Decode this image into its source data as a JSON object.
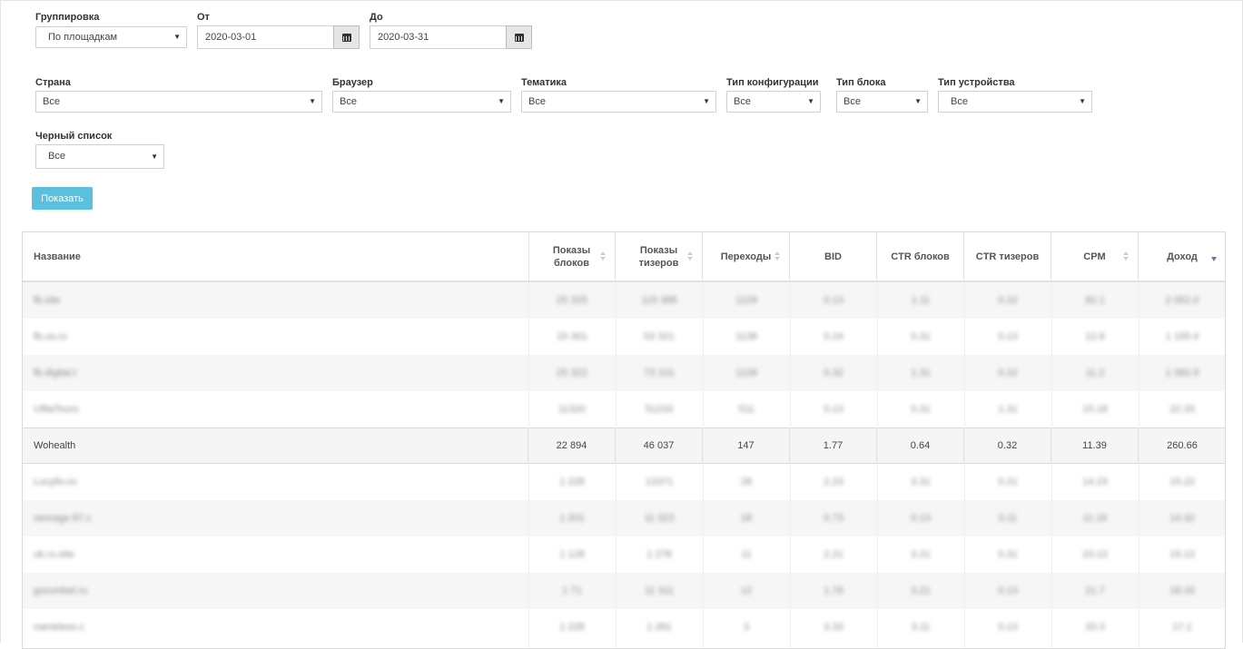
{
  "filters": {
    "grouping": {
      "label": "Группировка",
      "value": "По площадкам"
    },
    "from": {
      "label": "От",
      "value": "2020-03-01"
    },
    "to": {
      "label": "До",
      "value": "2020-03-31"
    },
    "country": {
      "label": "Страна",
      "value": "Все"
    },
    "browser": {
      "label": "Браузер",
      "value": "Все"
    },
    "theme": {
      "label": "Тематика",
      "value": "Все"
    },
    "config_type": {
      "label": "Тип конфигурации",
      "value": "Все"
    },
    "block_type": {
      "label": "Тип блока",
      "value": "Все"
    },
    "device_type": {
      "label": "Тип устройства",
      "value": "Все"
    },
    "blacklist": {
      "label": "Черный список",
      "value": "Все"
    }
  },
  "show_button": "Показать",
  "table": {
    "columns": [
      "Название",
      "Показы блоков",
      "Показы тизеров",
      "Переходы",
      "BID",
      "CTR блоков",
      "CTR тизеров",
      "CPM",
      "Доход"
    ],
    "sorted_column": "Доход",
    "rows": [
      {
        "blurred": true,
        "cells": [
          "fb.site",
          "25 325",
          "115 388",
          "1129",
          "0.13",
          "1.11",
          "0.22",
          "82.1",
          "2 052.0"
        ]
      },
      {
        "blurred": true,
        "cells": [
          "fb.us.ru",
          "15 301",
          "53 321",
          "1138",
          "0.24",
          "0.31",
          "0.13",
          "12.8",
          "1 155.4"
        ]
      },
      {
        "blurred": true,
        "cells": [
          "fb.digital.t",
          "25 322",
          "73 101",
          "1128",
          "0.32",
          "1.31",
          "0.22",
          "11.2",
          "1 082.9"
        ]
      },
      {
        "blurred": true,
        "cells": [
          "UfitaTours",
          "11320",
          "51233",
          "511",
          "0.13",
          "0.31",
          "1.31",
          "15.18",
          "22.33"
        ]
      },
      {
        "blurred": false,
        "highlight": true,
        "cells": [
          "Wohealth",
          "22 894",
          "46 037",
          "147",
          "1.77",
          "0.64",
          "0.32",
          "11.39",
          "260.66"
        ]
      },
      {
        "blurred": true,
        "cells": [
          "Lucyliv.co",
          "1 228",
          "13371",
          "28",
          "2.23",
          "3.31",
          "0.21",
          "14.23",
          "15.22"
        ]
      },
      {
        "blurred": true,
        "cells": [
          "zenrage.87.c",
          "1 201",
          "11 323",
          "18",
          "0.73",
          "0.13",
          "0.11",
          "11.16",
          "14.32"
        ]
      },
      {
        "blurred": true,
        "cells": [
          "uk.ru.site",
          "1 128",
          "1 278",
          "11",
          "2.21",
          "3.21",
          "0.31",
          "23.13",
          "19.13"
        ]
      },
      {
        "blurred": true,
        "cells": [
          "gurumbet.ru",
          "1 71",
          "11 311",
          "12",
          "1.78",
          "3.21",
          "0.13",
          "21.7",
          "18.33"
        ]
      },
      {
        "blurred": true,
        "cells": [
          "nameless.c",
          "1 228",
          "1 281",
          "3",
          "3.33",
          "3.11",
          "0.13",
          "33.3",
          "17.1"
        ]
      }
    ]
  }
}
